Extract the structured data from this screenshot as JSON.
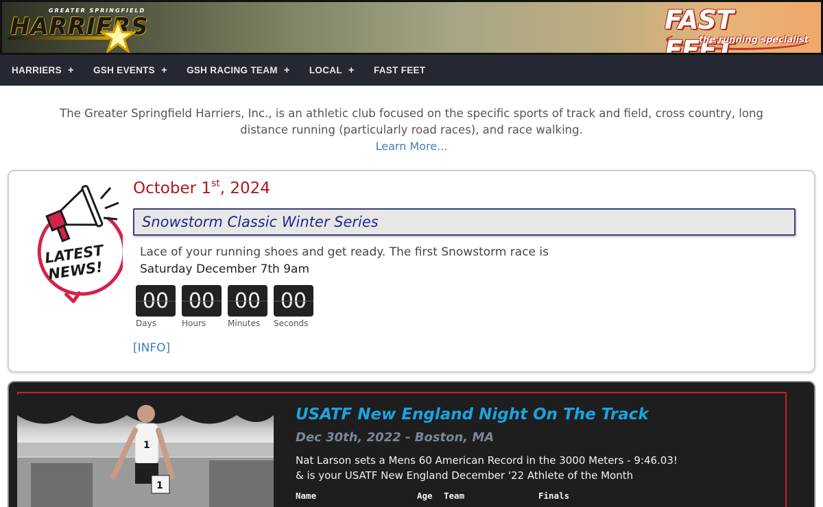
{
  "header": {
    "left_logo_text": "HARRIERS",
    "left_logo_small": "GREATER SPRINGFIELD",
    "right_logo_text": "FAST FEET",
    "right_logo_tagline": "the running specialist"
  },
  "nav": {
    "items": [
      {
        "label": "HARRIERS",
        "has_submenu": true
      },
      {
        "label": "GSH EVENTS",
        "has_submenu": true
      },
      {
        "label": "GSH RACING TEAM",
        "has_submenu": true
      },
      {
        "label": "LOCAL",
        "has_submenu": true
      },
      {
        "label": "FAST FEET",
        "has_submenu": false
      }
    ],
    "submenu_glyph": "+"
  },
  "intro": {
    "text": "The Greater Springfield Harriers, Inc., is an athletic club focused on the specific sports of track and field, cross country, long distance running (particularly road races), and race walking.",
    "link": "Learn More..."
  },
  "news": {
    "badge_line1": "LATEST",
    "badge_line2": "NEWS!",
    "date_main": "October 1",
    "date_suffix": "st",
    "date_year": ", 2024",
    "title": "Snowstorm Classic Winter Series",
    "text_line1": "Lace of your running shoes and get ready. The first Snowstorm race is",
    "text_line2": "Saturday December 7th 9am",
    "countdown": [
      {
        "value": "00",
        "label": "Days"
      },
      {
        "value": "00",
        "label": "Hours"
      },
      {
        "value": "00",
        "label": "Minutes"
      },
      {
        "value": "00",
        "label": "Seconds"
      }
    ],
    "info_link": "[INFO]"
  },
  "feature": {
    "title": "USATF New England Night On The Track",
    "subtitle": "Dec 30th, 2022 - Boston, MA",
    "desc_line1": "Nat Larson sets a Mens 60 American Record in the 3000 Meters - 9:46.03!",
    "desc_line2": "& is your USATF New England December '22 Athlete of the Month",
    "results_headers": [
      "Name",
      "Age",
      "Team",
      "Finals"
    ]
  },
  "colors": {
    "nav_bg": "#252733",
    "date_red": "#b3141c",
    "title_blue": "#1c2a8a",
    "link_blue": "#3f7fb7",
    "feature_title": "#1aa3e0",
    "frame_red": "#d41c1c"
  }
}
